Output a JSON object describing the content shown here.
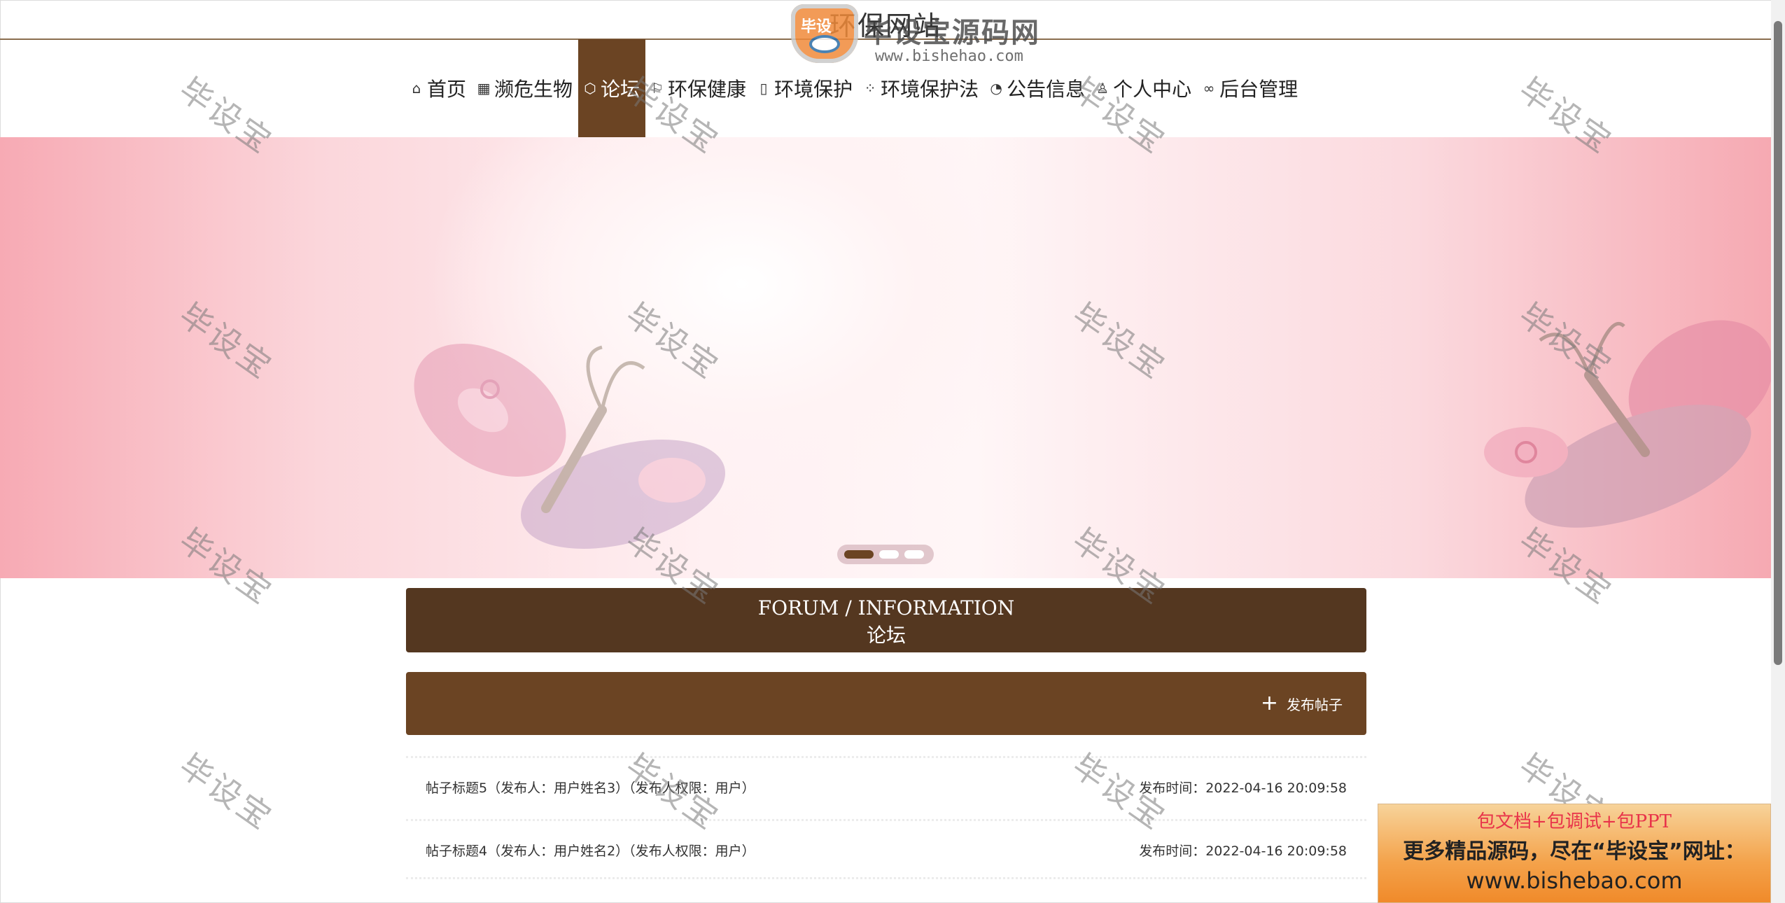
{
  "header": {
    "site_title": "环保网站"
  },
  "logo": {
    "badge_text": "毕设",
    "name": "毕设宝源码网",
    "url": "www.bishehao.com"
  },
  "nav": {
    "items": [
      {
        "label": "首页",
        "icon": "home-icon"
      },
      {
        "label": "濒危生物",
        "icon": "grid-icon"
      },
      {
        "label": "论坛",
        "icon": "cube-icon",
        "active": true
      },
      {
        "label": "环保健康",
        "icon": "flag-icon"
      },
      {
        "label": "环境保护",
        "icon": "note-icon"
      },
      {
        "label": "环境保护法",
        "icon": "apps-icon"
      },
      {
        "label": "公告信息",
        "icon": "palette-icon"
      },
      {
        "label": "个人中心",
        "icon": "user-icon"
      },
      {
        "label": "后台管理",
        "icon": "link-icon"
      }
    ]
  },
  "section": {
    "title_en": "FORUM / INFORMATION",
    "title_cn": "论坛"
  },
  "actions": {
    "publish_label": "发布帖子"
  },
  "posts": [
    {
      "title": "帖子标题5（发布人：用户姓名3）（发布人权限：用户）",
      "time": "发布时间：2022-04-16 20:09:58"
    },
    {
      "title": "帖子标题4（发布人：用户姓名2）（发布人权限：用户）",
      "time": "发布时间：2022-04-16 20:09:58"
    }
  ],
  "watermark": {
    "text": "毕设宝"
  },
  "ad": {
    "line1": "包文档+包调试+包PPT",
    "line2": "更多精品源码，尽在“毕设宝”网址：",
    "line3": "www.bishebao.com"
  },
  "colors": {
    "primary": "#6b4423",
    "dark": "#543720",
    "banner_pink": "#f7aab4"
  }
}
